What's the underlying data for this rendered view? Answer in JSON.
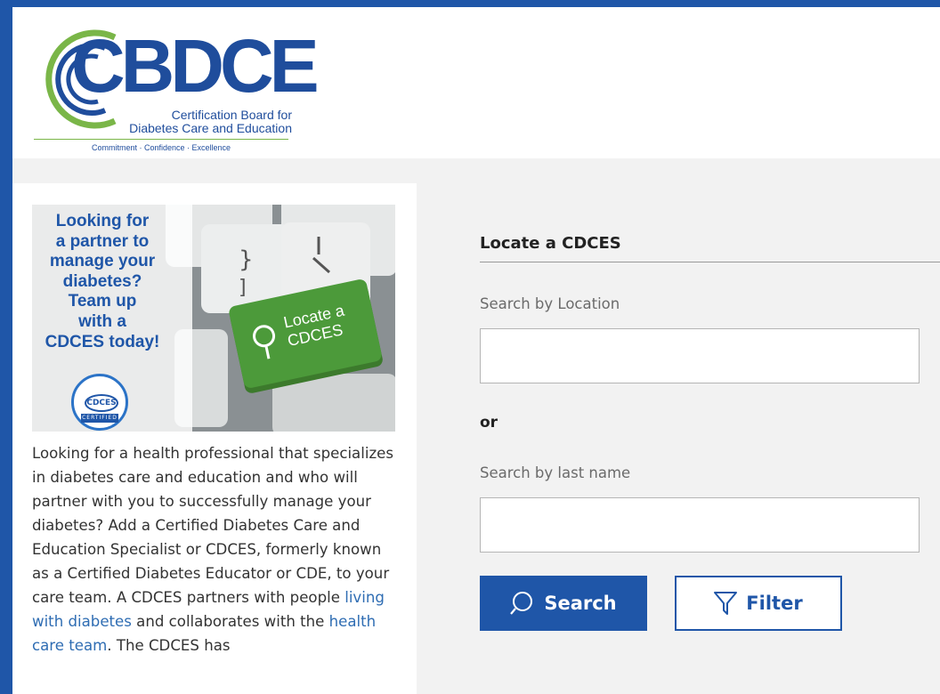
{
  "header": {
    "logo_text": "CBDCE",
    "logo_subtitle_line1": "Certification Board for",
    "logo_subtitle_line2": "Diabetes Care and Education",
    "logo_tagline": "Commitment · Confidence · Excellence"
  },
  "promo": {
    "headline_line1": "Looking for",
    "headline_line2": "a partner to",
    "headline_line3": "manage your",
    "headline_line4": "diabetes?",
    "headline_line5": "Team up",
    "headline_line6": "with a",
    "headline_line7": "CDCES today!",
    "key_text_line1": "Locate a",
    "key_text_line2": "CDCES",
    "badge_text": "CDCES",
    "badge_sub": "CERTIFIED"
  },
  "intro": {
    "text_before_link1": "Looking for a health professional that specializes in diabetes care and education and who will partner with you to successfully manage your diabetes? Add a Certified Diabetes Care and Education Specialist or CDCES, formerly known as a Certified Diabetes Educator or CDE, to your care team. A CDCES partners with people ",
    "link1": "living with diabetes",
    "text_between_links": " and collaborates with the ",
    "link2": "health care team",
    "text_after_link2": ". The CDCES has"
  },
  "locator": {
    "title": "Locate a CDCES",
    "location_label": "Search by Location",
    "location_value": "",
    "or_text": "or",
    "lastname_label": "Search by last name",
    "lastname_value": "",
    "search_button": "Search",
    "filter_button": "Filter"
  },
  "colors": {
    "brand_blue": "#1f56a8",
    "logo_green": "#7ab648",
    "link_blue": "#2f6db3"
  }
}
